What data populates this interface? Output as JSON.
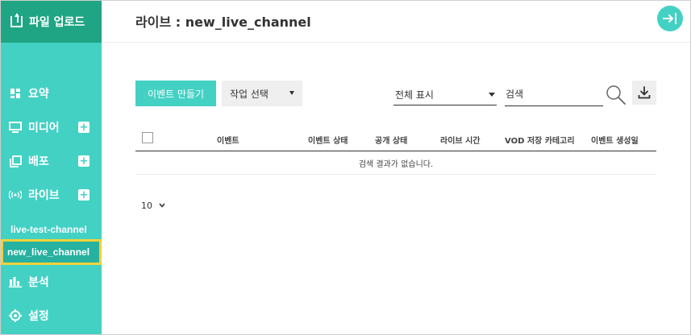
{
  "sidebar": {
    "upload_label": "파일 업로드",
    "items": [
      {
        "label": "요약",
        "icon": "dashboard-icon"
      },
      {
        "label": "미디어",
        "icon": "monitor-icon",
        "has_add": true
      },
      {
        "label": "배포",
        "icon": "copy-icon",
        "has_add": true
      },
      {
        "label": "라이브",
        "icon": "broadcast-icon",
        "has_add": true
      }
    ],
    "live_channels": [
      "live-test-channel",
      "new_live_channel"
    ],
    "bottom_items": [
      {
        "label": "분석",
        "icon": "bar-chart-icon"
      },
      {
        "label": "설정",
        "icon": "gear-icon"
      }
    ],
    "add_symbol": "+"
  },
  "header": {
    "title": "라이브 : new_live_channel"
  },
  "toolbar": {
    "create_label": "이벤트 만들기",
    "action_label": "작업 선택",
    "filter_label": "전체 표시",
    "search_placeholder": "검색"
  },
  "table": {
    "columns": [
      "이벤트",
      "이벤트 상태",
      "공개 상태",
      "라이브 시간",
      "VOD 저장 카테고리",
      "이벤트 생성일"
    ],
    "empty_message": "검색 결과가 없습니다."
  },
  "pagination": {
    "page_size": "10"
  },
  "colors": {
    "sidebar": "#43d1c4",
    "upload": "#1fa584",
    "active_border": "#f1d23a"
  }
}
